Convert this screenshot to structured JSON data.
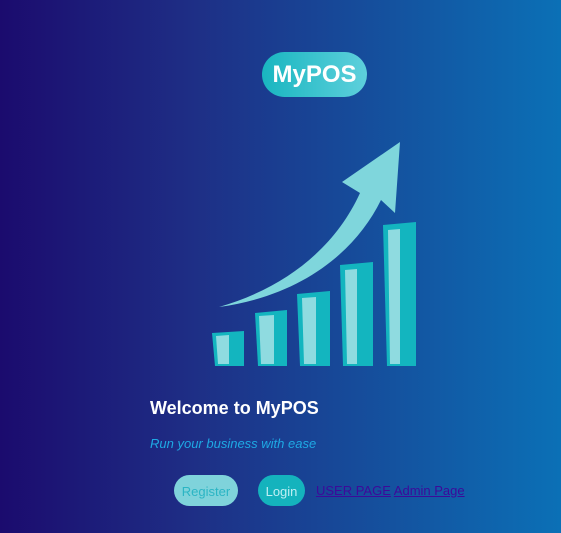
{
  "logo": {
    "text": "MyPOS"
  },
  "hero": {
    "icon": "growth-chart-arrow-icon"
  },
  "welcome": {
    "title": "Welcome to MyPOS",
    "tagline": "Run your business with ease"
  },
  "actions": {
    "register_label": "Register",
    "login_label": "Login",
    "user_page_link": "USER PAGE",
    "admin_page_link": "Admin Page"
  },
  "colors": {
    "teal": "#14b3bd",
    "light_teal": "#7fd3db",
    "link": "#3c0a9a",
    "tagline": "#1ea9e4"
  }
}
